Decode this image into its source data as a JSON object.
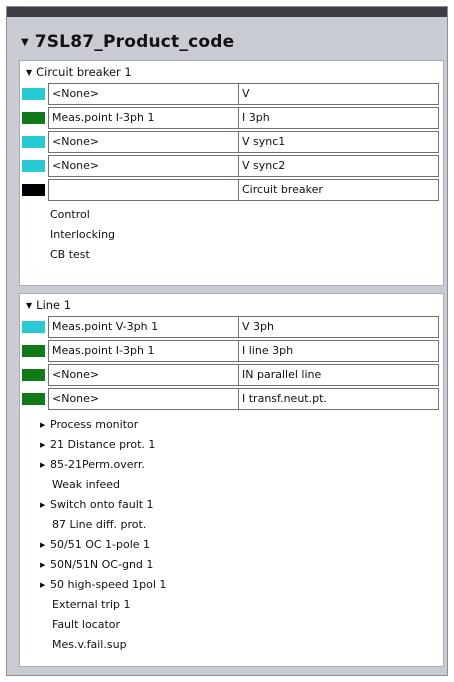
{
  "title": "7SL87_Product_code",
  "colors": {
    "cyan": "#27c9d2",
    "green": "#0f7a16",
    "black": "#000000"
  },
  "circuit_breaker": {
    "header": "Circuit breaker 1",
    "rows": [
      {
        "color": "cyan",
        "left": "<None>",
        "right": "V"
      },
      {
        "color": "green",
        "left": "Meas.point I-3ph 1",
        "right": "I 3ph"
      },
      {
        "color": "cyan",
        "left": "<None>",
        "right": "V sync1"
      },
      {
        "color": "cyan",
        "left": "<None>",
        "right": "V sync2"
      },
      {
        "color": "black",
        "left": "",
        "right": "Circuit breaker"
      }
    ],
    "items": [
      "Control",
      "Interlocking",
      "CB test"
    ]
  },
  "line": {
    "header": "Line 1",
    "rows": [
      {
        "color": "cyan",
        "left": "Meas.point V-3ph 1",
        "right": "V 3ph"
      },
      {
        "color": "green",
        "left": "Meas.point I-3ph 1",
        "right": "I line 3ph"
      },
      {
        "color": "green",
        "left": "<None>",
        "right": "IN parallel line"
      },
      {
        "color": "green",
        "left": "<None>",
        "right": "I transf.neut.pt."
      }
    ],
    "items": [
      {
        "label": "Process monitor",
        "expandable": true
      },
      {
        "label": "21 Distance prot. 1",
        "expandable": true
      },
      {
        "label": "85-21Perm.overr.",
        "expandable": true
      },
      {
        "label": "Weak infeed",
        "expandable": false
      },
      {
        "label": "Switch onto fault 1",
        "expandable": true
      },
      {
        "label": "87 Line diff. prot.",
        "expandable": false
      },
      {
        "label": "50/51 OC 1-pole 1",
        "expandable": true
      },
      {
        "label": "50N/51N OC-gnd 1",
        "expandable": true
      },
      {
        "label": "50 high-speed 1pol 1",
        "expandable": true
      },
      {
        "label": "External trip 1",
        "expandable": false
      },
      {
        "label": "Fault locator",
        "expandable": false
      },
      {
        "label": "Mes.v.fail.sup",
        "expandable": false
      }
    ]
  }
}
